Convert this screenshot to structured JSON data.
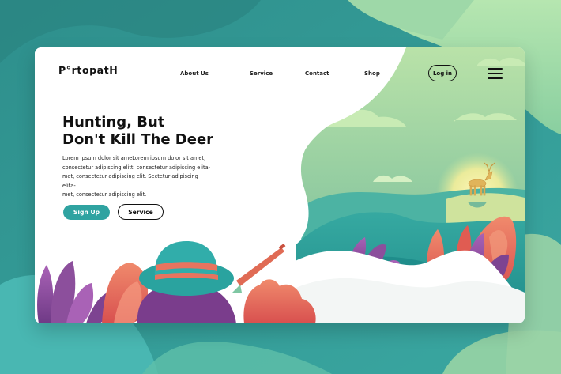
{
  "brand": {
    "logo_text": "P°rtopatH"
  },
  "nav": {
    "links": [
      {
        "label": "About Us"
      },
      {
        "label": "Service"
      },
      {
        "label": "Contact"
      },
      {
        "label": "Shop"
      }
    ],
    "login_label": "Log in",
    "menu_icon": "hamburger-menu-icon"
  },
  "hero": {
    "headline_line1": "Hunting, But",
    "headline_line2": "Don't Kill The Deer",
    "body_lines": [
      "Lorem ipsum dolor sit ameLorem ipsum dolor sit amet,",
      "consectetur adipiscing elitt, consectetur adipiscing elita-",
      "met, consectetur adipiscing elit. Sectetur adipiscing elita-",
      "met, consectetur adipiscing elit."
    ],
    "primary_button_label": "Sign Up",
    "secondary_button_label": "Service"
  },
  "colors": {
    "teal": "#2fa3a1",
    "dark_teal": "#1f7f7c",
    "mint": "#a8dca5",
    "coral": "#e86a5a",
    "purple": "#8c4f9c",
    "sun_yellow": "#fff3a0"
  }
}
